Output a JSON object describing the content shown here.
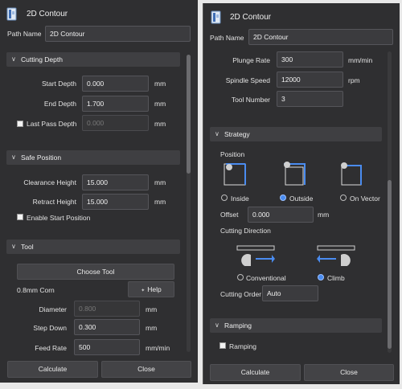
{
  "window_title": "2D Contour",
  "path_name_label": "Path Name",
  "path_name_value": "2D Contour",
  "cutting_depth": {
    "header": "Cutting Depth",
    "start_depth_label": "Start Depth",
    "start_depth_value": "0.000",
    "end_depth_label": "End Depth",
    "end_depth_value": "1.700",
    "last_pass_label": "Last Pass Depth",
    "last_pass_value": "0.000",
    "unit": "mm"
  },
  "safe_position": {
    "header": "Safe Position",
    "clearance_label": "Clearance Height",
    "clearance_value": "15.000",
    "retract_label": "Retract Height",
    "retract_value": "15.000",
    "unit": "mm",
    "enable_start_label": "Enable Start Position"
  },
  "tool": {
    "header": "Tool",
    "choose_tool_label": "Choose Tool",
    "tool_name": "0.8mm Corn",
    "help_label": "Help",
    "diameter_label": "Diameter",
    "diameter_value": "0.800",
    "step_down_label": "Step Down",
    "step_down_value": "0.300",
    "feed_rate_label": "Feed Rate",
    "feed_rate_value": "500",
    "unit_mm": "mm",
    "unit_mm_min": "mm/min"
  },
  "tool_cont": {
    "plunge_rate_label": "Plunge Rate",
    "plunge_rate_value": "300",
    "plunge_unit": "mm/min",
    "spindle_speed_label": "Spindle Speed",
    "spindle_speed_value": "12000",
    "spindle_unit": "rpm",
    "tool_number_label": "Tool Number",
    "tool_number_value": "3"
  },
  "strategy": {
    "header": "Strategy",
    "position_label": "Position",
    "inside_label": "Inside",
    "outside_label": "Outside",
    "on_vector_label": "On Vector",
    "selected_position": "Outside",
    "offset_label": "Offset",
    "offset_value": "0.000",
    "offset_unit": "mm",
    "cutting_direction_label": "Cutting Direction",
    "conventional_label": "Conventional",
    "climb_label": "Climb",
    "selected_direction": "Climb",
    "cutting_order_label": "Cutting Order",
    "cutting_order_value": "Auto"
  },
  "ramping": {
    "header": "Ramping",
    "ramping_label": "Ramping"
  },
  "footer": {
    "calculate_label": "Calculate",
    "close_label": "Close"
  },
  "colors": {
    "panel_bg": "#2f2f31",
    "field_bg": "#3b3b3e",
    "section_bg": "#3f3f42",
    "accent": "#4a8cf0"
  }
}
